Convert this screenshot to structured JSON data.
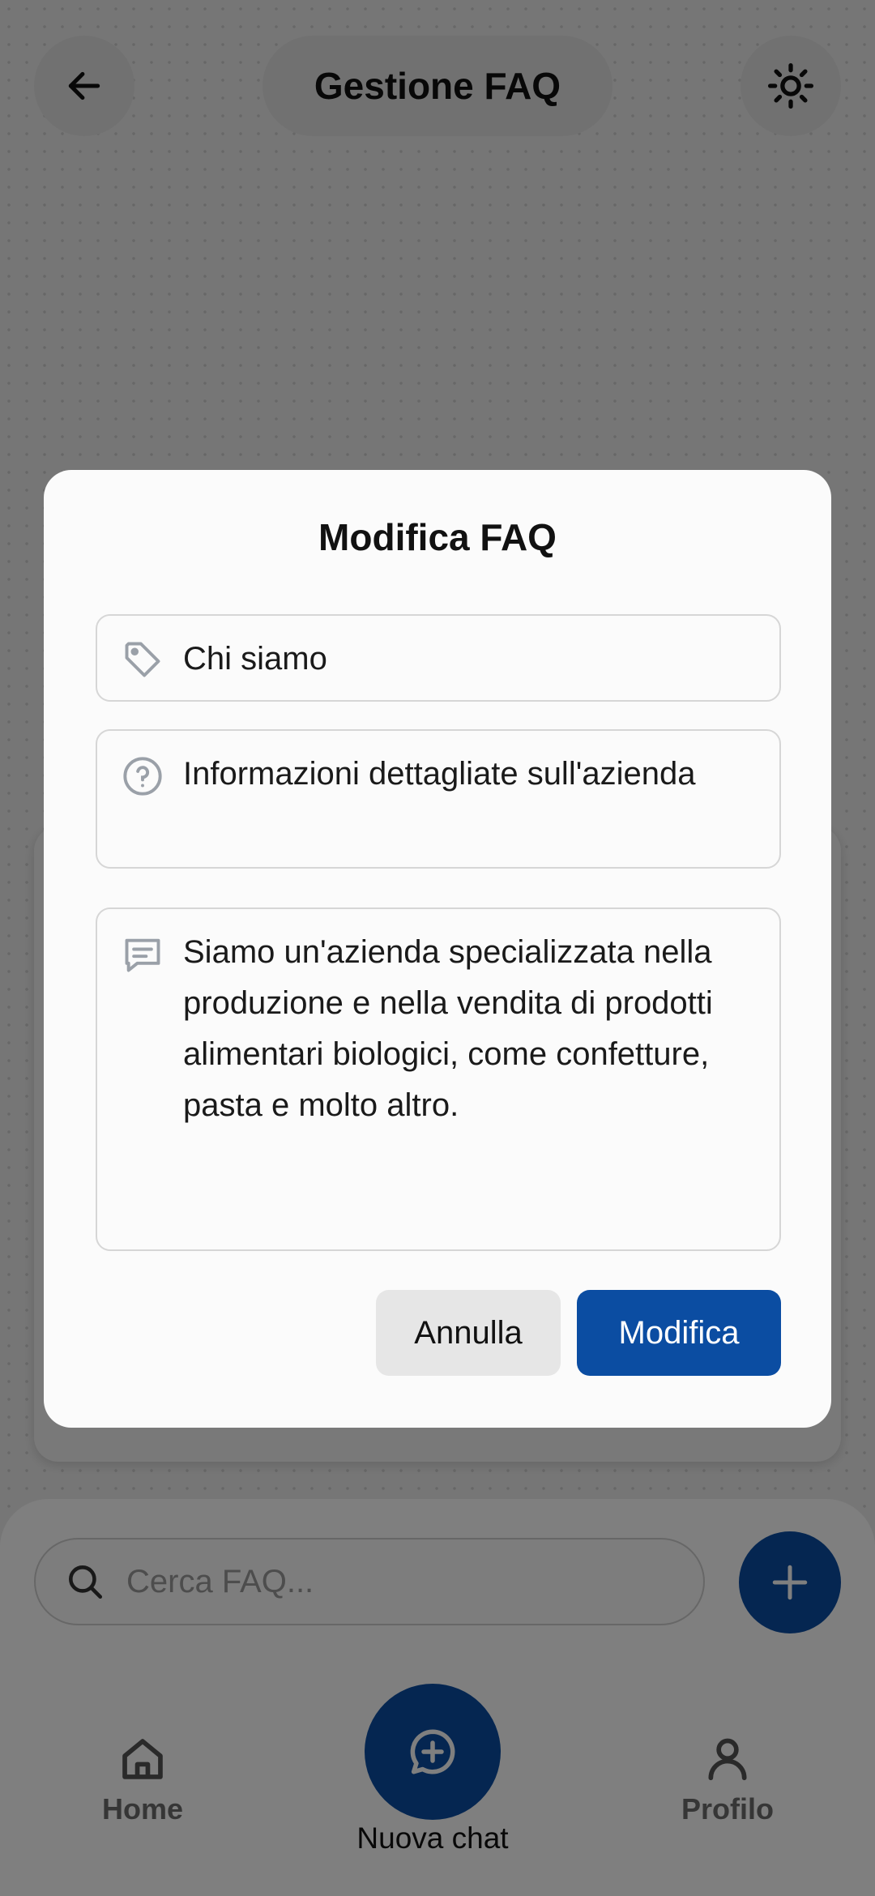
{
  "header": {
    "title": "Gestione FAQ",
    "back_icon": "arrow-left-icon",
    "theme_icon": "sun-icon"
  },
  "search": {
    "placeholder": "Cerca FAQ..."
  },
  "nav": {
    "home_label": "Home",
    "new_chat_label": "Nuova chat",
    "profile_label": "Profilo"
  },
  "dialog": {
    "title": "Modifica FAQ",
    "category_value": "Chi siamo",
    "question_value": "Informazioni dettagliate sull'azienda",
    "answer_value": "Siamo un'azienda specializzata nella produzione e nella vendita di prodotti alimentari biologici, come confetture, pasta e molto altro.",
    "cancel_label": "Annulla",
    "confirm_label": "Modifica"
  },
  "colors": {
    "primary": "#0b4da2",
    "scrim": "rgba(0,0,0,0.5)",
    "dialog_bg": "#fbfbfb"
  }
}
